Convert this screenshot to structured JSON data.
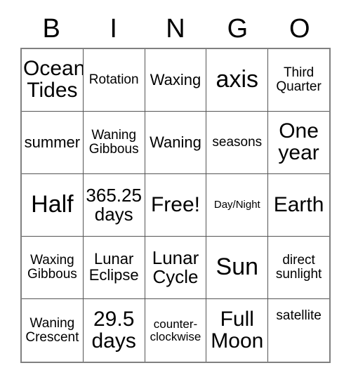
{
  "card": {
    "title_letters": [
      "B",
      "I",
      "N",
      "G",
      "O"
    ],
    "columns": 5,
    "rows": 5,
    "free_space": "Free!",
    "cells": [
      [
        {
          "text": "Ocean\nTides",
          "size": "fs-xxl"
        },
        {
          "text": "Rotation",
          "size": "fs-m"
        },
        {
          "text": "Waxing",
          "size": "fs-l"
        },
        {
          "text": "axis",
          "size": "fs-3xl"
        },
        {
          "text": "Third\nQuarter",
          "size": "fs-m"
        }
      ],
      [
        {
          "text": "summer",
          "size": "fs-l"
        },
        {
          "text": "Waning\nGibbous",
          "size": "fs-m"
        },
        {
          "text": "Waning",
          "size": "fs-l"
        },
        {
          "text": "seasons",
          "size": "fs-m"
        },
        {
          "text": "One\nyear",
          "size": "fs-xxl"
        }
      ],
      [
        {
          "text": "Half",
          "size": "fs-3xl"
        },
        {
          "text": "365.25\ndays",
          "size": "fs-xl"
        },
        {
          "text": "Free!",
          "size": "fs-xxl"
        },
        {
          "text": "Day/Night",
          "size": "fs-xs"
        },
        {
          "text": "Earth",
          "size": "fs-xxl"
        }
      ],
      [
        {
          "text": "Waxing\nGibbous",
          "size": "fs-m"
        },
        {
          "text": "Lunar\nEclipse",
          "size": "fs-l"
        },
        {
          "text": "Lunar\nCycle",
          "size": "fs-xl"
        },
        {
          "text": "Sun",
          "size": "fs-3xl"
        },
        {
          "text": "direct\nsunlight",
          "size": "fs-m"
        }
      ],
      [
        {
          "text": "Waning\nCrescent",
          "size": "fs-m"
        },
        {
          "text": "29.5\ndays",
          "size": "fs-xxl"
        },
        {
          "text": "counter-\nclockwise",
          "size": "fs-s"
        },
        {
          "text": "Full\nMoon",
          "size": "fs-xxl"
        },
        {
          "text": "satellite",
          "size": "fs-m",
          "valign": "align-top"
        }
      ]
    ]
  },
  "colors": {
    "background": "#ffffff",
    "text": "#000000",
    "grid_outer_border": "#808080",
    "grid_inner_border": "#555555"
  }
}
